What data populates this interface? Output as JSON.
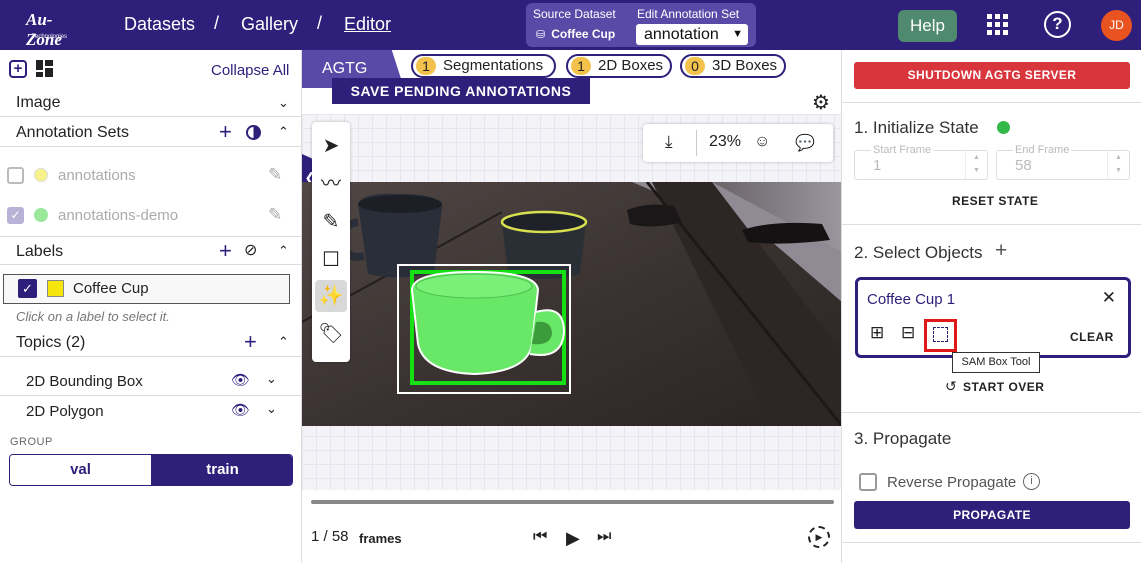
{
  "brand": {
    "name": "Au-Zone",
    "sub": "Technologies"
  },
  "breadcrumb": {
    "datasets": "Datasets",
    "sep": "/",
    "gallery": "Gallery",
    "editor": "Editor"
  },
  "source": {
    "label": "Source Dataset",
    "name": "Coffee Cup"
  },
  "annotation_set": {
    "label": "Edit Annotation Set",
    "value": "annotation"
  },
  "header": {
    "help": "Help",
    "avatar": "JD"
  },
  "left": {
    "collapse_all": "Collapse All",
    "image": "Image",
    "annotation_sets": "Annotation Sets",
    "sets": [
      {
        "name": "annotations",
        "color": "#f7f28c",
        "checked": false
      },
      {
        "name": "annotations-demo",
        "color": "#9be89b",
        "checked": true
      }
    ],
    "labels": "Labels",
    "label_item": {
      "name": "Coffee Cup",
      "color": "#f5e50a"
    },
    "hint": "Click on a label to select it.",
    "topics": "Topics (2)",
    "topic_items": [
      "2D Bounding Box",
      "2D Polygon"
    ],
    "group_label": "GROUP",
    "group": {
      "val": "val",
      "train": "train",
      "selected": "train"
    }
  },
  "middle": {
    "tab": "AGTG",
    "counts": [
      {
        "n": "1",
        "label": "Segmentations"
      },
      {
        "n": "1",
        "label": "2D Boxes"
      },
      {
        "n": "0",
        "label": "3D Boxes"
      }
    ],
    "save_pending": "SAVE PENDING ANNOTATIONS",
    "zoom": "23%",
    "frame_current": "1",
    "frame_total": "58",
    "frame_text": "1 / 58",
    "frames_label": "frames"
  },
  "right": {
    "shutdown": "SHUTDOWN AGTG SERVER",
    "step1": "1. Initialize State",
    "start_frame": {
      "label": "Start Frame",
      "value": "1"
    },
    "end_frame": {
      "label": "End Frame",
      "value": "58"
    },
    "reset_state": "RESET STATE",
    "step2": "2. Select Objects",
    "object": "Coffee Cup 1",
    "clear": "CLEAR",
    "tooltip": "SAM Box Tool",
    "start_over": "START OVER",
    "step3": "3. Propagate",
    "reverse": "Reverse Propagate",
    "propagate": "PROPAGATE"
  },
  "colors": {
    "brand": "#2e1f7a",
    "accent": "#5a4aa8",
    "danger": "#d9353d",
    "status_ok": "#35b84a",
    "help": "#4f8a6e"
  }
}
